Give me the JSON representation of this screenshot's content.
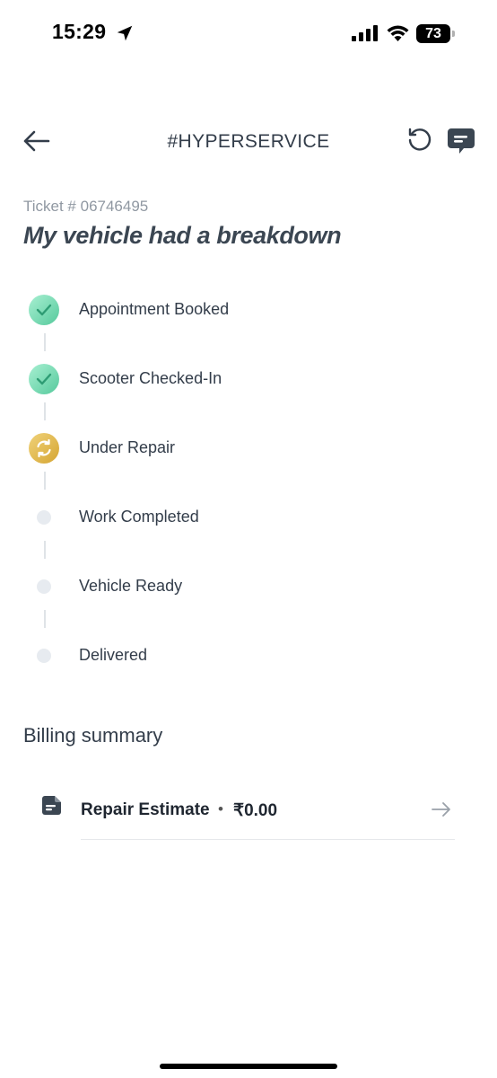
{
  "status_bar": {
    "time": "15:29",
    "battery": "73"
  },
  "header": {
    "title": "#HYPERSERVICE",
    "icons": [
      "arrow-left-icon",
      "history-icon",
      "chat-icon"
    ]
  },
  "ticket": {
    "number": "Ticket # 06746495",
    "title": "My vehicle had a breakdown"
  },
  "timeline": {
    "steps": [
      {
        "label": "Appointment Booked",
        "status": "completed"
      },
      {
        "label": "Scooter Checked-In",
        "status": "completed"
      },
      {
        "label": "Under Repair",
        "status": "in-progress"
      },
      {
        "label": "Work Completed",
        "status": "pending"
      },
      {
        "label": "Vehicle Ready",
        "status": "pending"
      },
      {
        "label": "Delivered",
        "status": "pending"
      }
    ]
  },
  "billing": {
    "title": "Billing summary",
    "items": [
      {
        "label": "Repair Estimate",
        "separator": "•",
        "amount": "₹0.00"
      }
    ]
  },
  "colors": {
    "completed": "#5fd3a8",
    "in_progress": "#e2b94a",
    "pending": "#e7ebf0",
    "text": "#333d4a"
  }
}
